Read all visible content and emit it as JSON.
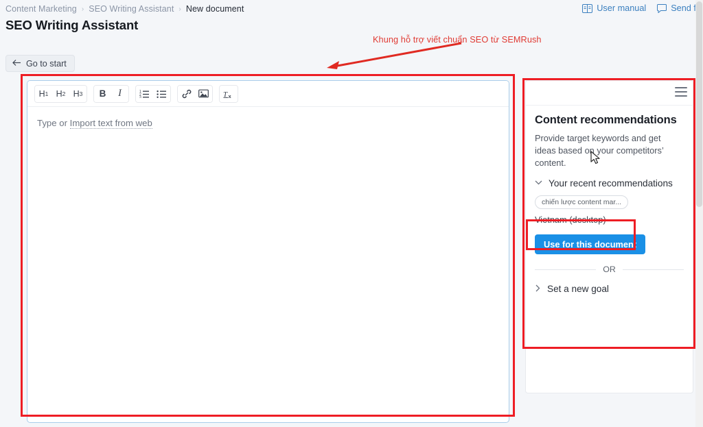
{
  "breadcrumb": {
    "items": [
      "Content Marketing",
      "SEO Writing Assistant",
      "New document"
    ],
    "separator": "›"
  },
  "page_title": "SEO Writing Assistant",
  "header_links": [
    {
      "label": "User manual",
      "icon": "book-icon"
    },
    {
      "label": "Send fee",
      "icon": "speech-bubble-icon"
    }
  ],
  "go_to_start": {
    "label": "Go to start",
    "icon": "arrow-left-icon"
  },
  "annotation": {
    "text": "Khung hỗ trợ viết chuẩn SEO từ SEMRush",
    "color": "#e03a33",
    "box_color": "#ee1d24"
  },
  "editor": {
    "toolbar": {
      "groups": [
        {
          "name": "headings",
          "buttons": [
            {
              "label": "H",
              "sub": "1",
              "name": "heading-1-button"
            },
            {
              "label": "H",
              "sub": "2",
              "name": "heading-2-button"
            },
            {
              "label": "H",
              "sub": "3",
              "name": "heading-3-button"
            }
          ]
        },
        {
          "name": "text-style",
          "buttons": [
            {
              "label": "B",
              "name": "bold-button"
            },
            {
              "label": "I",
              "name": "italic-button"
            }
          ]
        },
        {
          "name": "lists",
          "buttons": [
            {
              "label": "",
              "name": "ordered-list-button"
            },
            {
              "label": "",
              "name": "bulleted-list-button"
            }
          ]
        },
        {
          "name": "insert",
          "buttons": [
            {
              "label": "",
              "name": "link-icon"
            },
            {
              "label": "",
              "name": "image-icon"
            }
          ]
        },
        {
          "name": "clear",
          "buttons": [
            {
              "label": "",
              "name": "clear-formatting-button"
            }
          ]
        }
      ]
    },
    "placeholder_prefix": "Type or ",
    "placeholder_link": "Import text from web"
  },
  "panel": {
    "menu_icon": "hamburger-icon",
    "title": "Content recommendations",
    "description": "Provide target keywords and get ideas based on your competitors’ content.",
    "recent_section": {
      "label": "Your recent recommendations",
      "chevron": "⌄",
      "keyword_tag": "chiến lược content mar...",
      "region": "Vietnam (desktop)",
      "use_button": "Use for this document"
    },
    "or_label": "OR",
    "new_goal": {
      "label": "Set a new goal",
      "chevron": "›"
    }
  },
  "colors": {
    "accent_blue": "#1a90e6",
    "link_blue": "#3a7fbf",
    "annotation_red": "#ee1d24",
    "page_bg": "#f4f6f9"
  }
}
